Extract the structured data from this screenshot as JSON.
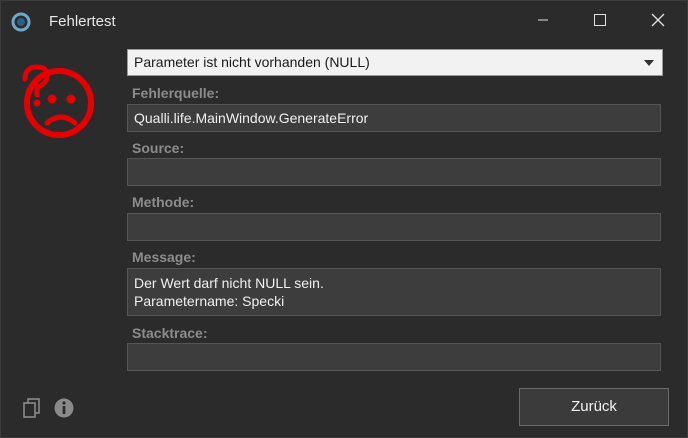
{
  "window": {
    "title": "Fehlertest",
    "icons": {
      "app": "app-logo-icon",
      "minimize": "minimize-icon",
      "maximize": "maximize-icon",
      "close": "close-icon"
    }
  },
  "error_icon": {
    "name": "sad-face-question-icon",
    "color": "#e60000"
  },
  "error_type": {
    "selected": "Parameter ist nicht vorhanden (NULL)"
  },
  "fields": {
    "fehlerquelle": {
      "label": "Fehlerquelle:",
      "value": "Qualli.life.MainWindow.GenerateError"
    },
    "source": {
      "label": "Source:",
      "value": ""
    },
    "methode": {
      "label": "Methode:",
      "value": ""
    },
    "message": {
      "label": "Message:",
      "value": "Der Wert darf nicht NULL sein.\nParametername: Specki"
    },
    "stacktrace": {
      "label": "Stacktrace:",
      "value": ""
    }
  },
  "footer": {
    "copy_icon": "copy-icon",
    "info_icon": "info-icon",
    "back_label": "Zurück"
  }
}
